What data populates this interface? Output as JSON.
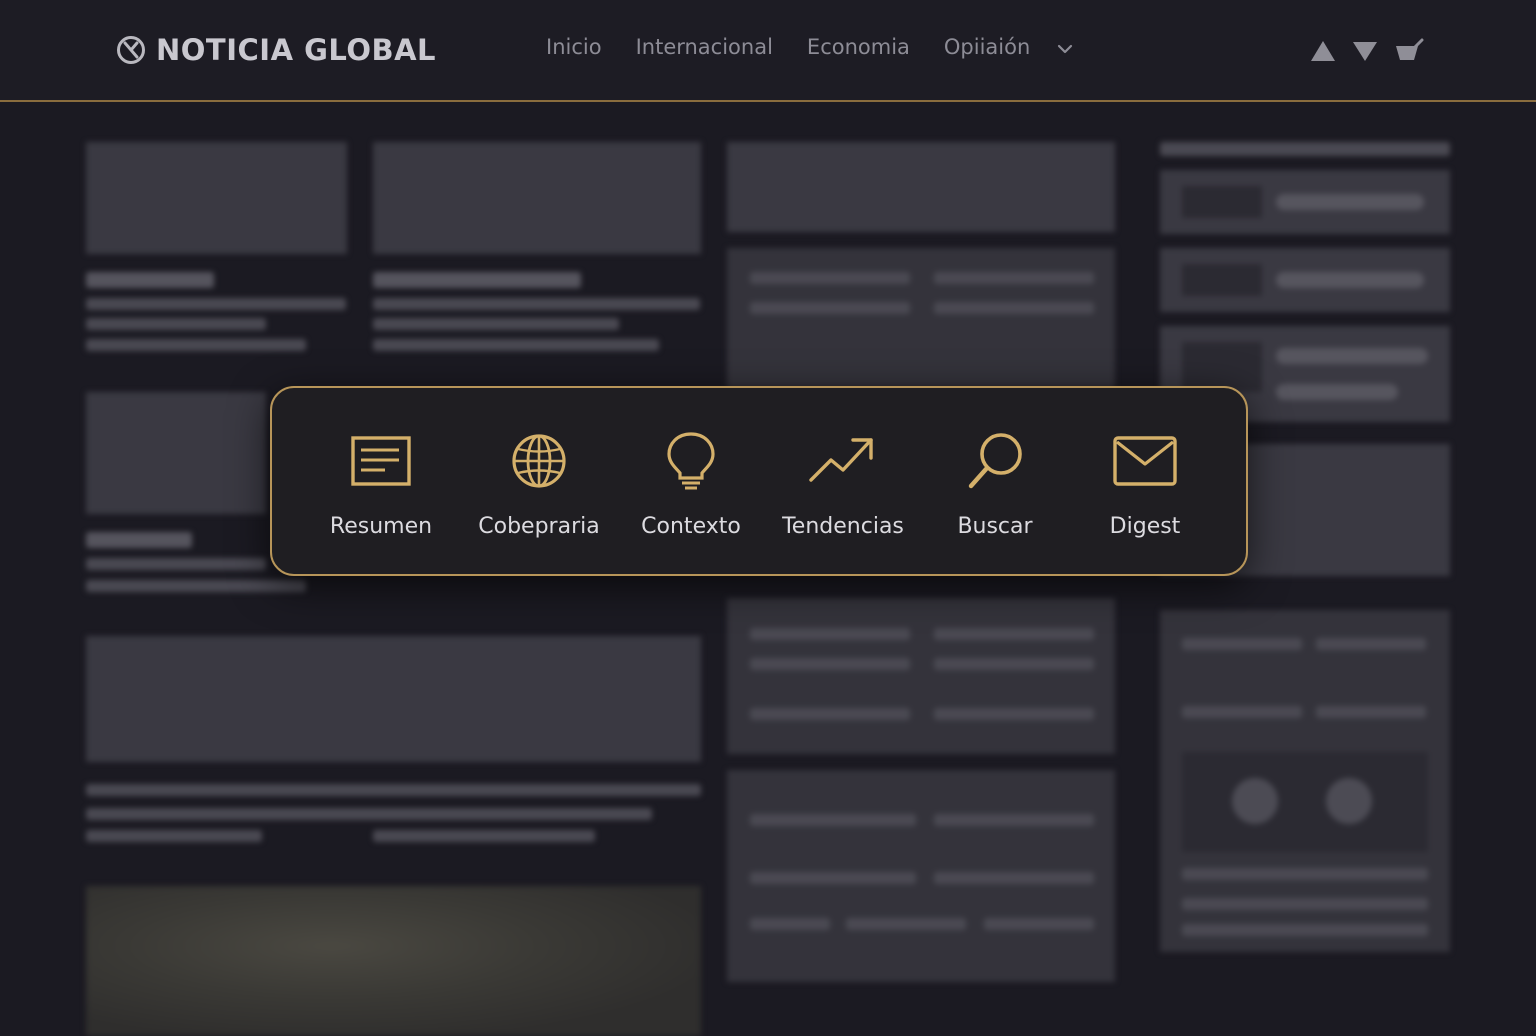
{
  "header": {
    "brand_name": "NOTICIA GLOBAL",
    "brand_icon": "globe-slash-logo",
    "nav_items": [
      {
        "label": "Inicio"
      },
      {
        "label": "Internacional"
      },
      {
        "label": "Economia"
      },
      {
        "label": "Opiiaión"
      }
    ],
    "nav_more_icon": "chevron-down-icon",
    "tool_icons": [
      "triangle-up-icon",
      "triangle-down-icon",
      "cart-icon"
    ]
  },
  "toolbar": {
    "items": [
      {
        "label": "Resumen",
        "icon": "document-lines-icon"
      },
      {
        "label": "Cobeprarіa",
        "icon": "globe-icon"
      },
      {
        "label": "Contexto",
        "icon": "lightbulb-icon"
      },
      {
        "label": "Tendencias",
        "icon": "trend-up-icon"
      },
      {
        "label": "Buscar",
        "icon": "search-icon"
      },
      {
        "label": "Digest",
        "icon": "envelope-icon"
      }
    ]
  },
  "colors": {
    "accent": "#d4b06a",
    "background": "#1b1a22",
    "header_divider": "#8a6d3e"
  }
}
